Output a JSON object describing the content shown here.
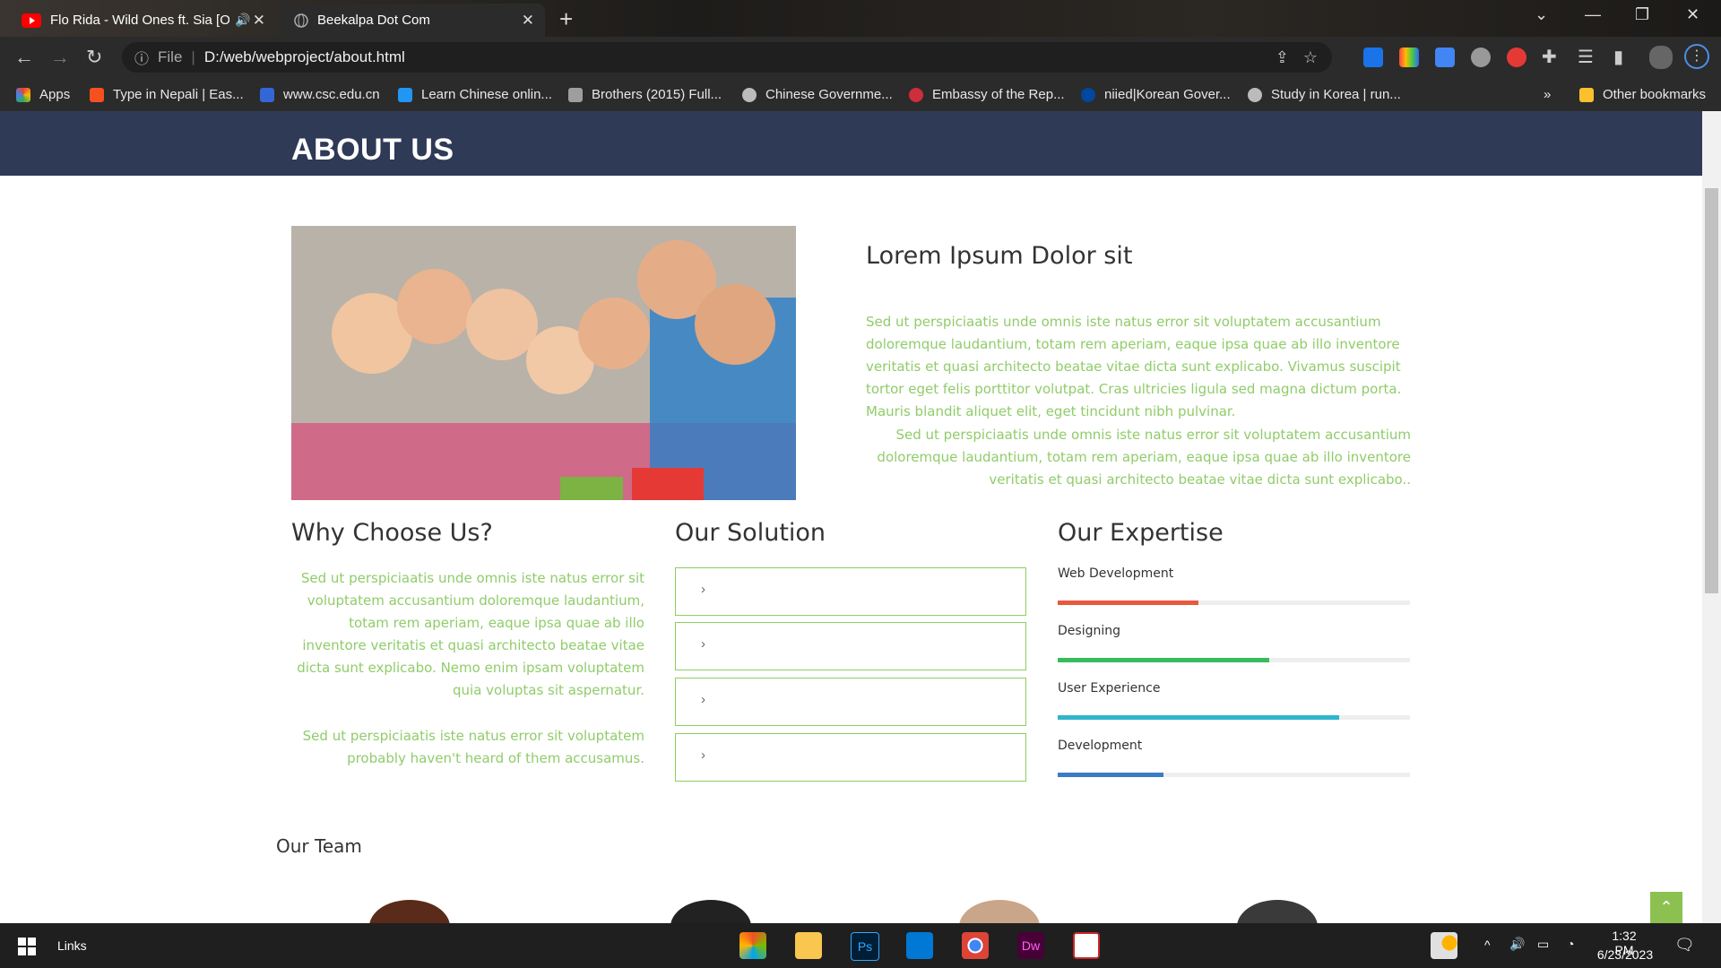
{
  "tabs": [
    {
      "title": "Flo Rida - Wild Ones ft. Sia [O",
      "audio": true
    },
    {
      "title": "Beekalpa Dot Com"
    }
  ],
  "address": {
    "scheme_label": "File",
    "url": "D:/web/webproject/about.html"
  },
  "bookmarks": [
    {
      "label": "Apps",
      "color": "#e94235"
    },
    {
      "label": "Type in Nepali | Eas...",
      "color": "#f4511e"
    },
    {
      "label": "www.csc.edu.cn",
      "color": "#3367d6"
    },
    {
      "label": "Learn Chinese onlin...",
      "color": "#2196f3"
    },
    {
      "label": "Brothers (2015) Full...",
      "color": "#9e9e9e"
    },
    {
      "label": "Chinese Governme...",
      "color": "#bbbbbb"
    },
    {
      "label": "Embassy of the Rep...",
      "color": "#cd2e3a"
    },
    {
      "label": "niied|Korean Gover...",
      "color": "#0047a0"
    },
    {
      "label": "Study in Korea | run...",
      "color": "#bbbbbb"
    }
  ],
  "bookmarks_more": "»",
  "other_bookmarks": "Other bookmarks",
  "page": {
    "banner_title": "ABOUT US",
    "intro": {
      "heading": "Lorem Ipsum Dolor sit",
      "para1": "Sed ut perspiciaatis unde omnis iste natus error sit voluptatem accusantium doloremque laudantium, totam rem aperiam, eaque ipsa quae ab illo inventore veritatis et quasi architecto beatae vitae dicta sunt explicabo. Vivamus suscipit tortor eget felis porttitor volutpat. Cras ultricies ligula sed magna dictum porta. Mauris blandit aliquet elit, eget tincidunt nibh pulvinar.",
      "para2": "Sed ut perspiciaatis unde omnis iste natus error sit voluptatem accusantium doloremque laudantium, totam rem aperiam, eaque ipsa quae ab illo inventore veritatis et quasi architecto beatae vitae dicta sunt explicabo.."
    },
    "why": {
      "heading": "Why Choose Us?",
      "para1": "Sed ut perspiciaatis unde omnis iste natus error sit voluptatem accusantium doloremque laudantium, totam rem aperiam, eaque ipsa quae ab illo inventore veritatis et quasi architecto beatae vitae dicta sunt explicabo. Nemo enim ipsam voluptatem quia voluptas sit aspernatur.",
      "para2": "Sed ut perspiciaatis iste natus error sit voluptatem probably haven't heard of them accusamus."
    },
    "solution": {
      "heading": "Our Solution",
      "items": [
        "›",
        "›",
        "›",
        "›"
      ]
    },
    "expertise": {
      "heading": "Our Expertise",
      "skills": [
        {
          "label": "Web Development",
          "level": 0.4,
          "color": "#e9573f"
        },
        {
          "label": "Designing",
          "level": 0.6,
          "color": "#37bc5b"
        },
        {
          "label": "User Experience",
          "level": 0.8,
          "color": "#2fb6cc"
        },
        {
          "label": "Development",
          "level": 0.3,
          "color": "#3b7dc4"
        }
      ]
    },
    "team_heading": "Our Team",
    "to_top": "⌃"
  },
  "taskbar": {
    "links_label": "Links",
    "time": "1:32 PM",
    "date": "6/23/2023"
  }
}
